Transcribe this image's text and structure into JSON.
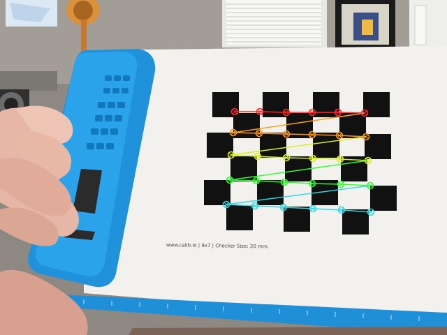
{
  "checkerboard_caption": "www.calib.io | 9x7 | Checker Size: 20 mm.",
  "colors": {
    "wall": "#9c9891",
    "board_paper": "#f2f1ee",
    "blue_clipboard": "#1f8fd8",
    "dark_square": "#111111",
    "corner_rows": [
      "#ff2a2a",
      "#ff9a1a",
      "#d8ef1f",
      "#2fff2f",
      "#34d6e0"
    ]
  },
  "detected_corners": {
    "rows": 5,
    "points_per_row": 6
  }
}
